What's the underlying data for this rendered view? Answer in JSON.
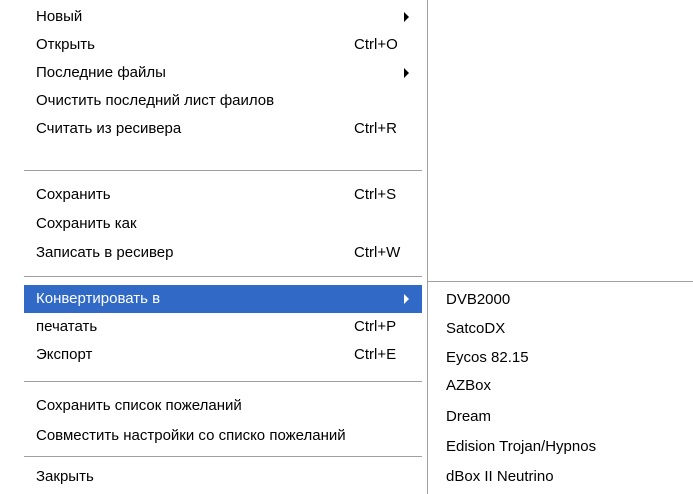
{
  "menu": {
    "items": [
      {
        "label": "Новый",
        "shortcut": "",
        "submenu": true
      },
      {
        "label": "Открыть",
        "shortcut": "Ctrl+O",
        "submenu": false
      },
      {
        "label": "Последние файлы",
        "shortcut": "",
        "submenu": true
      },
      {
        "label": "Очистить последний лист фаилов",
        "shortcut": "",
        "submenu": false
      },
      {
        "label": "Считать из ресивера",
        "shortcut": "Ctrl+R",
        "submenu": false
      },
      {
        "label": "Сохранить",
        "shortcut": "Ctrl+S",
        "submenu": false
      },
      {
        "label": " Сохранить как",
        "shortcut": "",
        "submenu": false
      },
      {
        "label": "Записать в ресивер",
        "shortcut": "Ctrl+W",
        "submenu": false
      },
      {
        "label": "Конвертировать в",
        "shortcut": "",
        "submenu": true,
        "active": true
      },
      {
        "label": "печатать",
        "shortcut": "Ctrl+P",
        "submenu": false
      },
      {
        "label": "Экспорт",
        "shortcut": "Ctrl+E",
        "submenu": false
      },
      {
        "label": "Сохранить список пожеланий",
        "shortcut": "",
        "submenu": false
      },
      {
        "label": "Совместить настройки со списко пожеланий",
        "shortcut": "",
        "submenu": false
      },
      {
        "label": "Закрыть",
        "shortcut": "",
        "submenu": false
      }
    ]
  },
  "submenu": {
    "items": [
      {
        "label": "DVB2000"
      },
      {
        "label": "SatcoDX"
      },
      {
        "label": "Eycos 82.15"
      },
      {
        "label": "AZBox"
      },
      {
        "label": "Dream"
      },
      {
        "label": "Edision Trojan/Hypnos"
      },
      {
        "label": "dBox II Neutrino"
      }
    ]
  },
  "colors": {
    "highlight": "#3169c6",
    "separator": "#a0a0a0",
    "background": "#ffffff"
  }
}
